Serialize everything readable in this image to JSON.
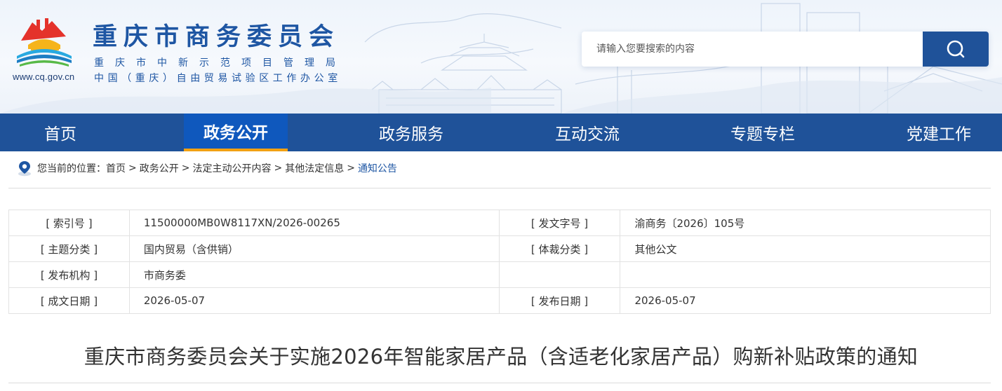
{
  "header": {
    "site_title": "重庆市商务委员会",
    "subtitle_line1": "重庆市中新示范项目管理局",
    "subtitle_line2": "中国（重庆）自由贸易试验区工作办公室",
    "domain": "www.cq.gov.cn",
    "search_placeholder": "请输入您要搜索的内容"
  },
  "nav": {
    "items": [
      {
        "label": "首页",
        "active": false
      },
      {
        "label": "政务公开",
        "active": true
      },
      {
        "label": "政务服务",
        "active": false
      },
      {
        "label": "互动交流",
        "active": false
      },
      {
        "label": "专题专栏",
        "active": false
      },
      {
        "label": "党建工作",
        "active": false
      }
    ]
  },
  "breadcrumb": {
    "prefix": "您当前的位置：",
    "items": [
      "首页",
      "政务公开",
      "法定主动公开内容",
      "其他法定信息",
      "通知公告"
    ],
    "separator": ">"
  },
  "info": {
    "rows": [
      {
        "l1": "[ 索引号 ]",
        "v1": "11500000MB0W8117XN/2026-00265",
        "l2": "[ 发文字号 ]",
        "v2": "渝商务〔2026〕105号"
      },
      {
        "l1": "[ 主题分类 ]",
        "v1": "国内贸易（含供销）",
        "l2": "[ 体裁分类 ]",
        "v2": "其他公文"
      },
      {
        "l1": "[ 发布机构 ]",
        "v1": "市商务委",
        "l2": "",
        "v2": ""
      },
      {
        "l1": "[ 成文日期 ]",
        "v1": "2026-05-07",
        "l2": "[ 发布日期 ]",
        "v2": "2026-05-07"
      }
    ]
  },
  "article": {
    "title": "重庆市商务委员会关于实施2026年智能家居产品（含适老化家居产品）购新补贴政策的通知"
  },
  "colors": {
    "nav_bg": "#1f5299",
    "nav_active": "#0f58bd",
    "nav_active_underline": "#f2a112",
    "title_blue": "#1e56a3"
  },
  "icons": {
    "search": "search-icon",
    "location": "location-pin-icon",
    "logo": "government-emblem-logo"
  }
}
